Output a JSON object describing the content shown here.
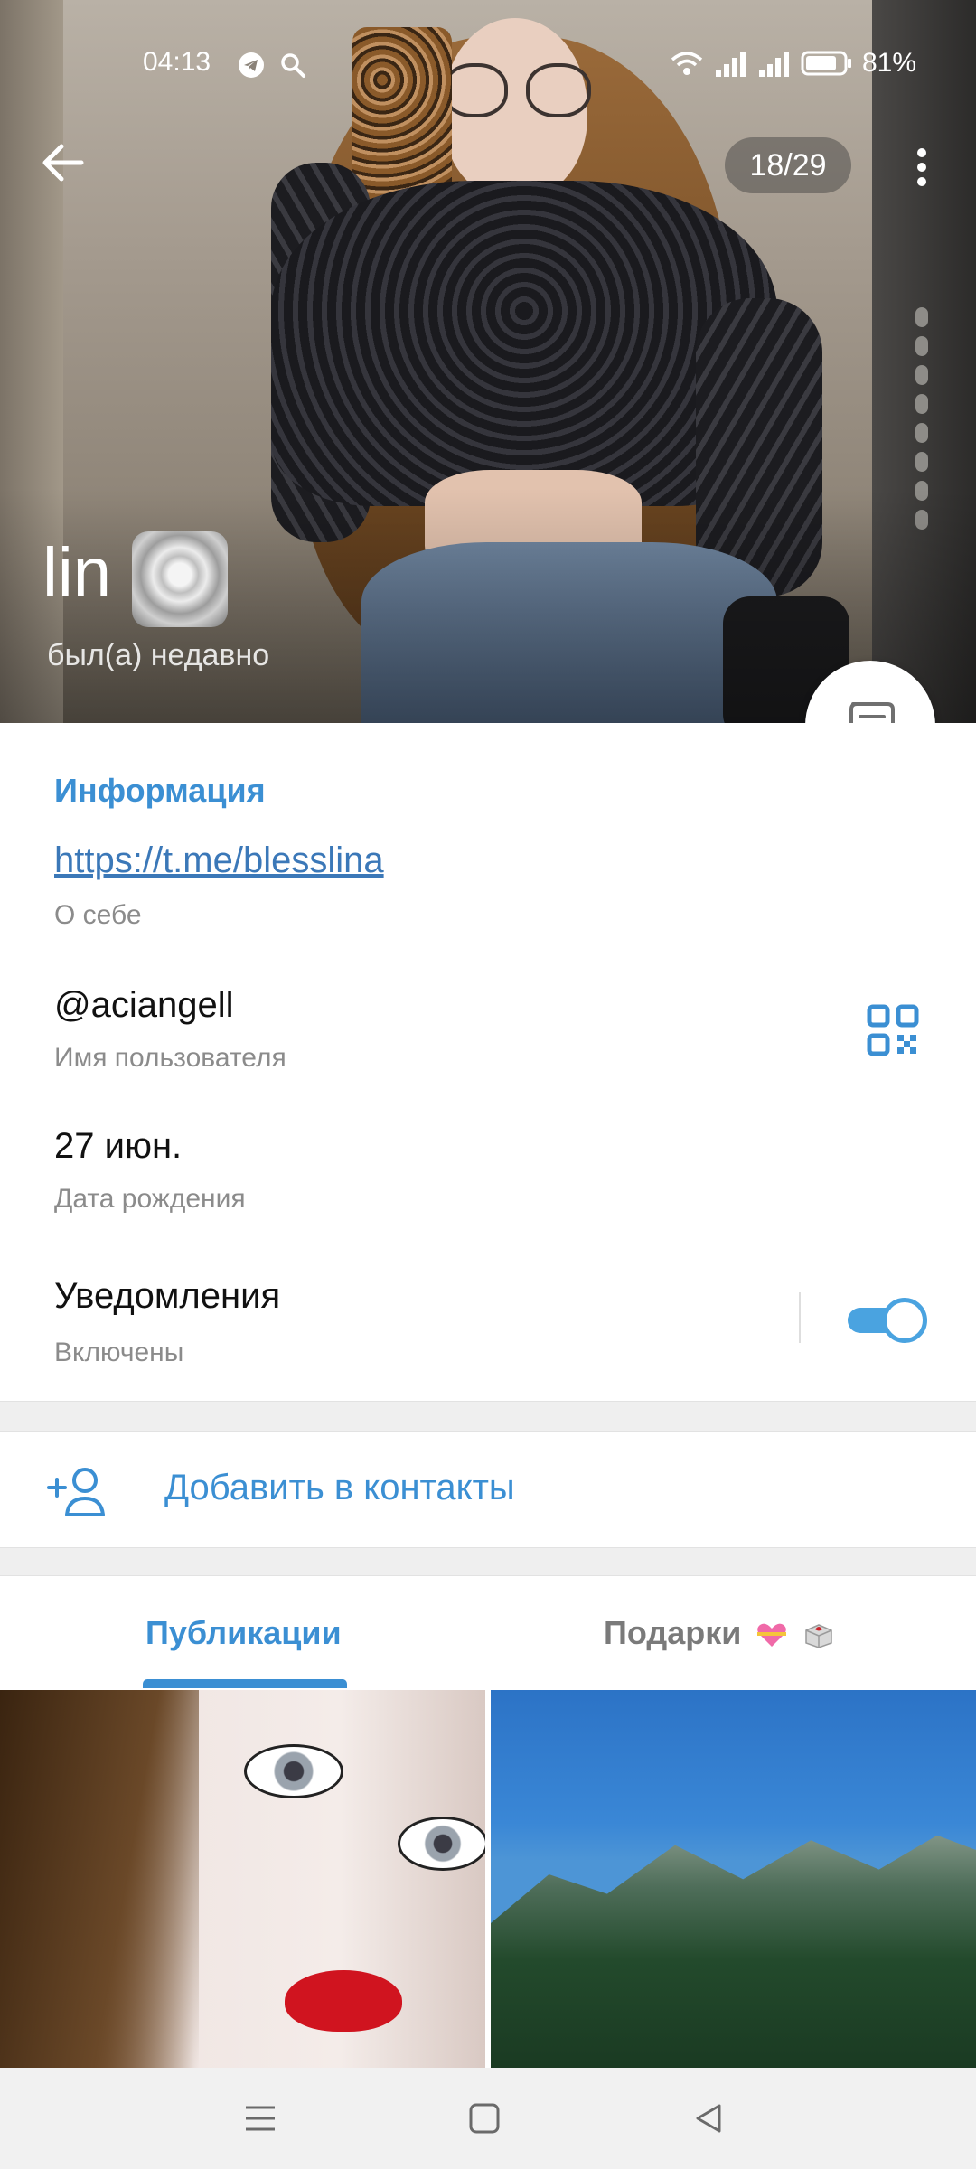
{
  "status_bar": {
    "time": "04:13",
    "battery": "81%",
    "icons": [
      "telegram-icon",
      "search-icon",
      "wifi-icon",
      "signal-icon",
      "signal-icon",
      "battery-icon"
    ]
  },
  "header": {
    "photo_counter": "18/29",
    "name": "lin",
    "name_emoji": "white-rose-emoji",
    "last_seen": "был(а) недавно"
  },
  "info": {
    "section_title": "Информация",
    "bio_link": "https://t.me/blesslina",
    "bio_caption": "О себе",
    "username": "@aciangell",
    "username_caption": "Имя пользователя",
    "birthday": "27 июн.",
    "birthday_caption": "Дата рождения",
    "notifications_label": "Уведомления",
    "notifications_status": "Включены",
    "notifications_enabled": true
  },
  "actions": {
    "add_contact": "Добавить в контакты"
  },
  "tabs": [
    {
      "label": "Публикации",
      "active": true
    },
    {
      "label": "Подарки",
      "active": false
    }
  ],
  "colors": {
    "accent": "#3b8fd3",
    "link": "#3b78b8",
    "caption": "#8b8b8b"
  }
}
